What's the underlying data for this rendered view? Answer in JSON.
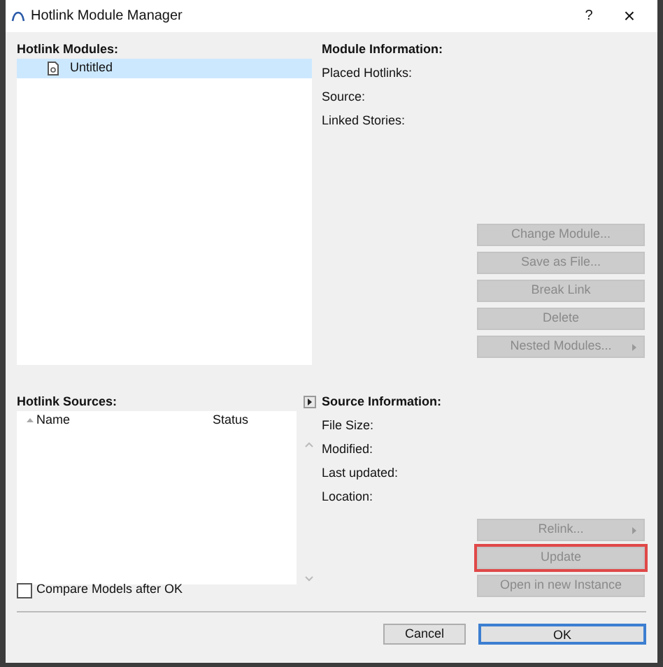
{
  "window": {
    "title": "Hotlink Module Manager",
    "help": "?",
    "close": "×"
  },
  "modules": {
    "label": "Hotlink Modules:",
    "items": [
      {
        "name": "Untitled",
        "selected": true
      }
    ]
  },
  "module_info": {
    "title": "Module Information:",
    "fields": [
      "Placed Hotlinks:",
      "Source:",
      "Linked Stories:"
    ]
  },
  "module_buttons": [
    {
      "label": "Change Module...",
      "disabled": true,
      "submenu": false,
      "highlighted": false
    },
    {
      "label": "Save as File...",
      "disabled": true,
      "submenu": false,
      "highlighted": false
    },
    {
      "label": "Break Link",
      "disabled": true,
      "submenu": false,
      "highlighted": false
    },
    {
      "label": "Delete",
      "disabled": true,
      "submenu": false,
      "highlighted": false
    },
    {
      "label": "Nested Modules...",
      "disabled": true,
      "submenu": true,
      "highlighted": false
    }
  ],
  "sources": {
    "label": "Hotlink Sources:",
    "columns": [
      {
        "label": "Name",
        "sorted": true
      },
      {
        "label": "Status",
        "sorted": false
      }
    ],
    "expanded": false
  },
  "source_info": {
    "title": "Source Information:",
    "fields": [
      "File Size:",
      "Modified:",
      "Last updated:",
      "Location:"
    ]
  },
  "source_buttons": [
    {
      "label": "Relink...",
      "disabled": true,
      "submenu": true,
      "highlighted": false
    },
    {
      "label": "Update",
      "disabled": true,
      "submenu": false,
      "highlighted": true
    },
    {
      "label": "Open in new Instance",
      "disabled": true,
      "submenu": false,
      "highlighted": false
    }
  ],
  "compare": {
    "label": "Compare Models after OK",
    "checked": false
  },
  "footer_buttons": [
    {
      "label": "Cancel",
      "default": false
    },
    {
      "label": "OK",
      "default": true
    }
  ]
}
